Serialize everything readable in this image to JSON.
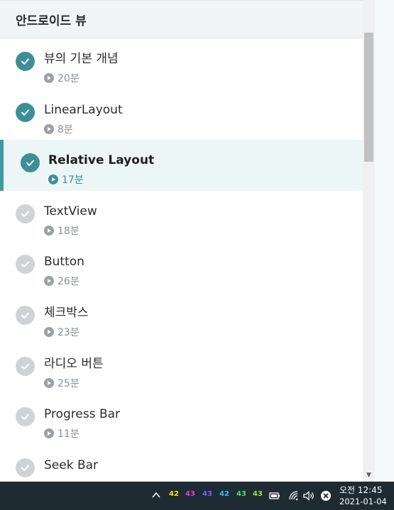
{
  "section": {
    "title": "안드로이드 뷰"
  },
  "lessons": [
    {
      "title": "뷰의 기본 개념",
      "duration": "20분",
      "completed": true,
      "active": false
    },
    {
      "title": "LinearLayout",
      "duration": "8분",
      "completed": true,
      "active": false
    },
    {
      "title": "Relative Layout",
      "duration": "17분",
      "completed": true,
      "active": true
    },
    {
      "title": "TextView",
      "duration": "18분",
      "completed": false,
      "active": false
    },
    {
      "title": "Button",
      "duration": "26분",
      "completed": false,
      "active": false
    },
    {
      "title": "체크박스",
      "duration": "23분",
      "completed": false,
      "active": false
    },
    {
      "title": "라디오 버튼",
      "duration": "25분",
      "completed": false,
      "active": false
    },
    {
      "title": "Progress Bar",
      "duration": "11분",
      "completed": false,
      "active": false
    },
    {
      "title": "Seek Bar",
      "duration": "",
      "completed": false,
      "active": false
    }
  ],
  "taskbar": {
    "cpu_cores": [
      {
        "value": "42",
        "color": "#f2e21b"
      },
      {
        "value": "43",
        "color": "#e23ce2"
      },
      {
        "value": "43",
        "color": "#7b5cff"
      },
      {
        "value": "42",
        "color": "#3fb6ff"
      },
      {
        "value": "43",
        "color": "#3ee07a"
      },
      {
        "value": "43",
        "color": "#9be22f"
      }
    ],
    "clock_time": "오전 12:45",
    "clock_date": "2021-01-04",
    "icons": [
      "chevron-up-icon",
      "battery-icon",
      "wifi-icon",
      "volume-icon",
      "close-circle-icon"
    ]
  },
  "colors": {
    "accent": "#3d8f97",
    "active_bg": "#ecf6f7",
    "incomplete": "#cfd3d7"
  }
}
